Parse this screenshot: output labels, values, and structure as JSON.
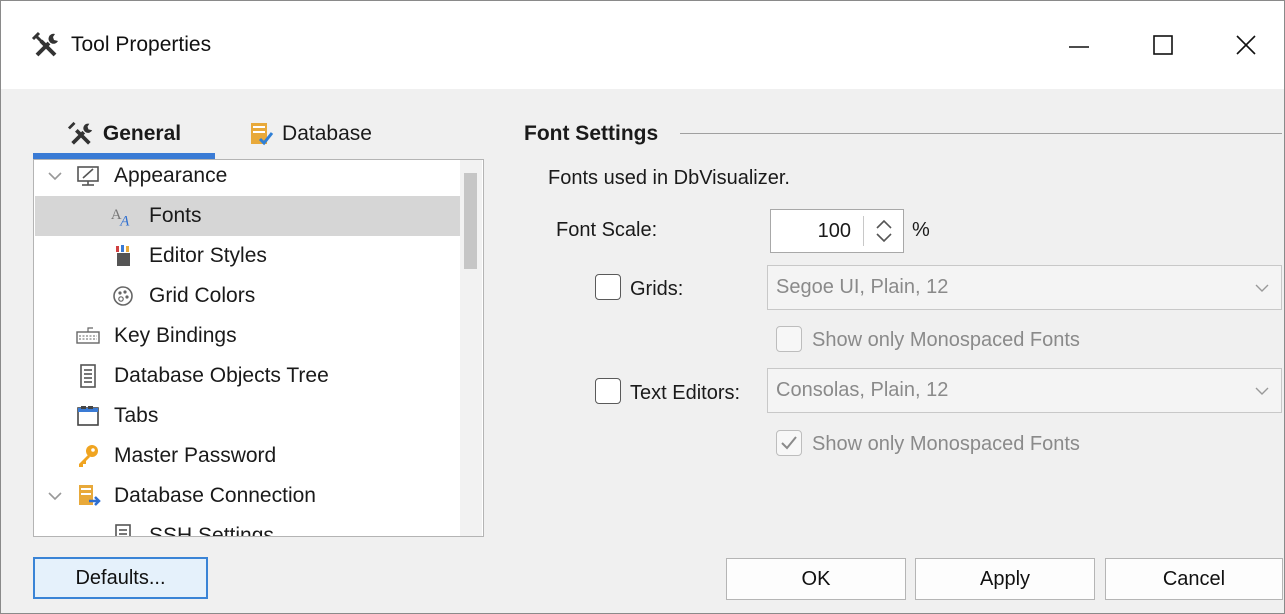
{
  "window": {
    "title": "Tool Properties",
    "app_icon": "tools-icon",
    "controls": [
      "minimize-icon",
      "maximize-icon",
      "close-icon"
    ]
  },
  "tabs": [
    {
      "label": "General",
      "icon": "tools-icon",
      "active": true
    },
    {
      "label": "Database",
      "icon": "database-icon",
      "active": false
    }
  ],
  "tree": {
    "items": [
      {
        "label": "Appearance",
        "icon": "monitor-icon",
        "expanded": true,
        "level": 0
      },
      {
        "label": "Fonts",
        "icon": "font-icon",
        "selected": true,
        "level": 1
      },
      {
        "label": "Editor Styles",
        "icon": "paint-icon",
        "level": 1
      },
      {
        "label": "Grid Colors",
        "icon": "palette-icon",
        "level": 1
      },
      {
        "label": "Key Bindings",
        "icon": "keyboard-icon",
        "level": 0
      },
      {
        "label": "Database Objects Tree",
        "icon": "tree-doc-icon",
        "level": 0
      },
      {
        "label": "Tabs",
        "icon": "tabs-icon",
        "level": 0
      },
      {
        "label": "Master Password",
        "icon": "key-icon",
        "level": 0
      },
      {
        "label": "Database Connection",
        "icon": "database-connection-icon",
        "expanded": true,
        "level": 0
      },
      {
        "label": "SSH Settings",
        "icon": "ssh-icon",
        "level": 1
      }
    ]
  },
  "font_settings": {
    "section_title": "Font Settings",
    "description": "Fonts used in DbVisualizer.",
    "font_scale_label": "Font Scale:",
    "font_scale_value": "100",
    "font_scale_unit": "%",
    "grids": {
      "label": "Grids:",
      "checked": false,
      "value": "Segoe UI, Plain, 12",
      "monospaced_label": "Show only Monospaced Fonts",
      "monospaced_checked": false
    },
    "text_editors": {
      "label": "Text Editors:",
      "checked": false,
      "value": "Consolas, Plain, 12",
      "monospaced_label": "Show only Monospaced Fonts",
      "monospaced_checked": true
    }
  },
  "buttons": {
    "defaults": "Defaults...",
    "ok": "OK",
    "apply": "Apply",
    "cancel": "Cancel"
  },
  "colors": {
    "accent": "#3a7bd5",
    "selection": "#d6d6d6",
    "disabled_text": "#8a8a8a"
  }
}
